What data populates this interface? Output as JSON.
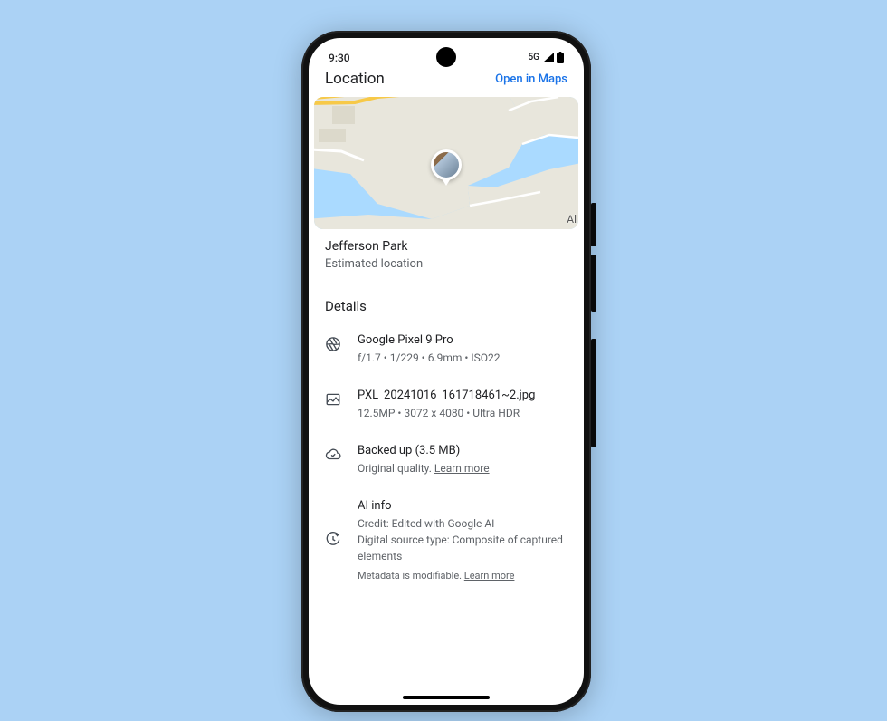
{
  "status": {
    "time": "9:30",
    "network": "5G"
  },
  "header": {
    "title": "Location",
    "open_link": "Open in Maps"
  },
  "map": {
    "corner_label": "Al"
  },
  "location": {
    "name": "Jefferson Park",
    "subtext": "Estimated location"
  },
  "details": {
    "title": "Details",
    "camera": {
      "device": "Google Pixel 9 Pro",
      "specs": "f/1.7  •  1/229  •  6.9mm  •  ISO22"
    },
    "file": {
      "name": "PXL_20241016_161718461~2.jpg",
      "specs": "12.5MP  •  3072 x 4080  • Ultra HDR"
    },
    "backup": {
      "status": "Backed up (3.5 MB)",
      "quality": "Original quality.",
      "learn_more": "Learn more"
    },
    "ai": {
      "title": "AI info",
      "credit": "Credit: Edited with Google AI",
      "source": "Digital source type: Composite of captured elements",
      "note": "Metadata is modifiable.",
      "learn_more": "Learn more"
    }
  }
}
